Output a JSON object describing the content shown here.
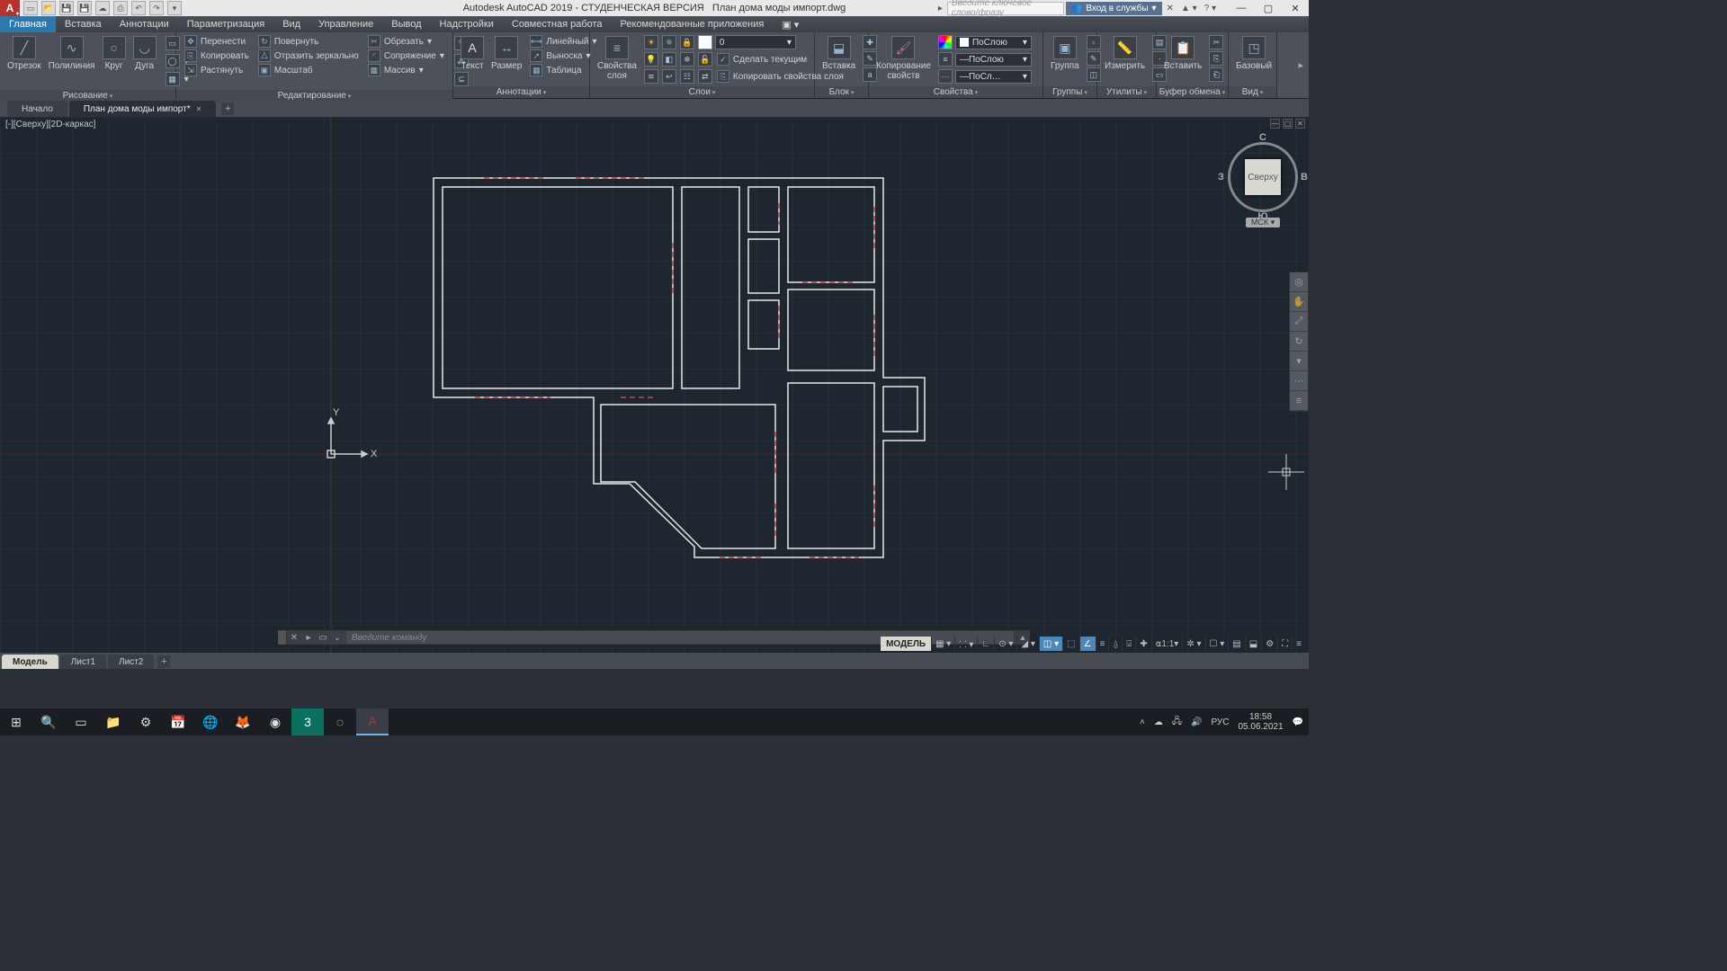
{
  "title": {
    "version": "Autodesk AutoCAD 2019 - СТУДЕНЧЕСКАЯ ВЕРСИЯ",
    "file": "План дома моды импорт.dwg"
  },
  "search_placeholder": "Введите ключевое слово/фразу",
  "signin": "Вход в службы",
  "menu": [
    "Главная",
    "Вставка",
    "Аннотации",
    "Параметризация",
    "Вид",
    "Управление",
    "Вывод",
    "Надстройки",
    "Совместная работа",
    "Рекомендованные приложения"
  ],
  "panels": {
    "draw": {
      "title": "Рисование",
      "line": "Отрезок",
      "pline": "Полилиния",
      "circle": "Круг",
      "arc": "Дуга"
    },
    "modify": {
      "title": "Редактирование",
      "move": "Перенести",
      "rotate": "Повернуть",
      "copy": "Копировать",
      "mirror": "Отразить зеркально",
      "stretch": "Растянуть",
      "scale": "Масштаб",
      "trim": "Обрезать",
      "fillet": "Сопряжение",
      "array": "Массив"
    },
    "annot": {
      "title": "Аннотации",
      "text": "Текст",
      "dim": "Размер",
      "linear": "Линейный",
      "leader": "Выноска",
      "table": "Таблица"
    },
    "layers": {
      "title": "Слои",
      "prop": "Свойства\nслоя",
      "current": "0",
      "mkcur": "Сделать текущим",
      "matchlayer": "Копировать свойства слоя"
    },
    "block": {
      "title": "Блок",
      "insert": "Вставка"
    },
    "props": {
      "title": "Свойства",
      "copyprops": "Копирование\nсвойств",
      "bylayer": "ПоСлою",
      "bylayer2": "ПоСлою",
      "bylayer3": "ПоСл…"
    },
    "group": {
      "title": "Группы",
      "group": "Группа"
    },
    "util": {
      "title": "Утилиты",
      "measure": "Измерить"
    },
    "clip": {
      "title": "Буфер обмена",
      "paste": "Вставить"
    },
    "view": {
      "title": "Вид",
      "basic": "Базовый"
    }
  },
  "tabs": {
    "start": "Начало",
    "file": "План дома моды импорт*"
  },
  "viewport_label": "[-][Сверху][2D-каркас]",
  "viewcube": {
    "top": "С",
    "right": "В",
    "bottom": "Ю",
    "left": "З",
    "face": "Сверху",
    "ucs": "МСК"
  },
  "cmd_placeholder": "Введите команду",
  "modeltabs": {
    "model": "Модель",
    "l1": "Лист1",
    "l2": "Лист2"
  },
  "model_badge": "МОДЕЛЬ",
  "scale_11": "1:1",
  "lang": "РУС",
  "clock": {
    "time": "18:58",
    "date": "05.06.2021"
  },
  "axes": {
    "x": "X",
    "y": "Y"
  }
}
